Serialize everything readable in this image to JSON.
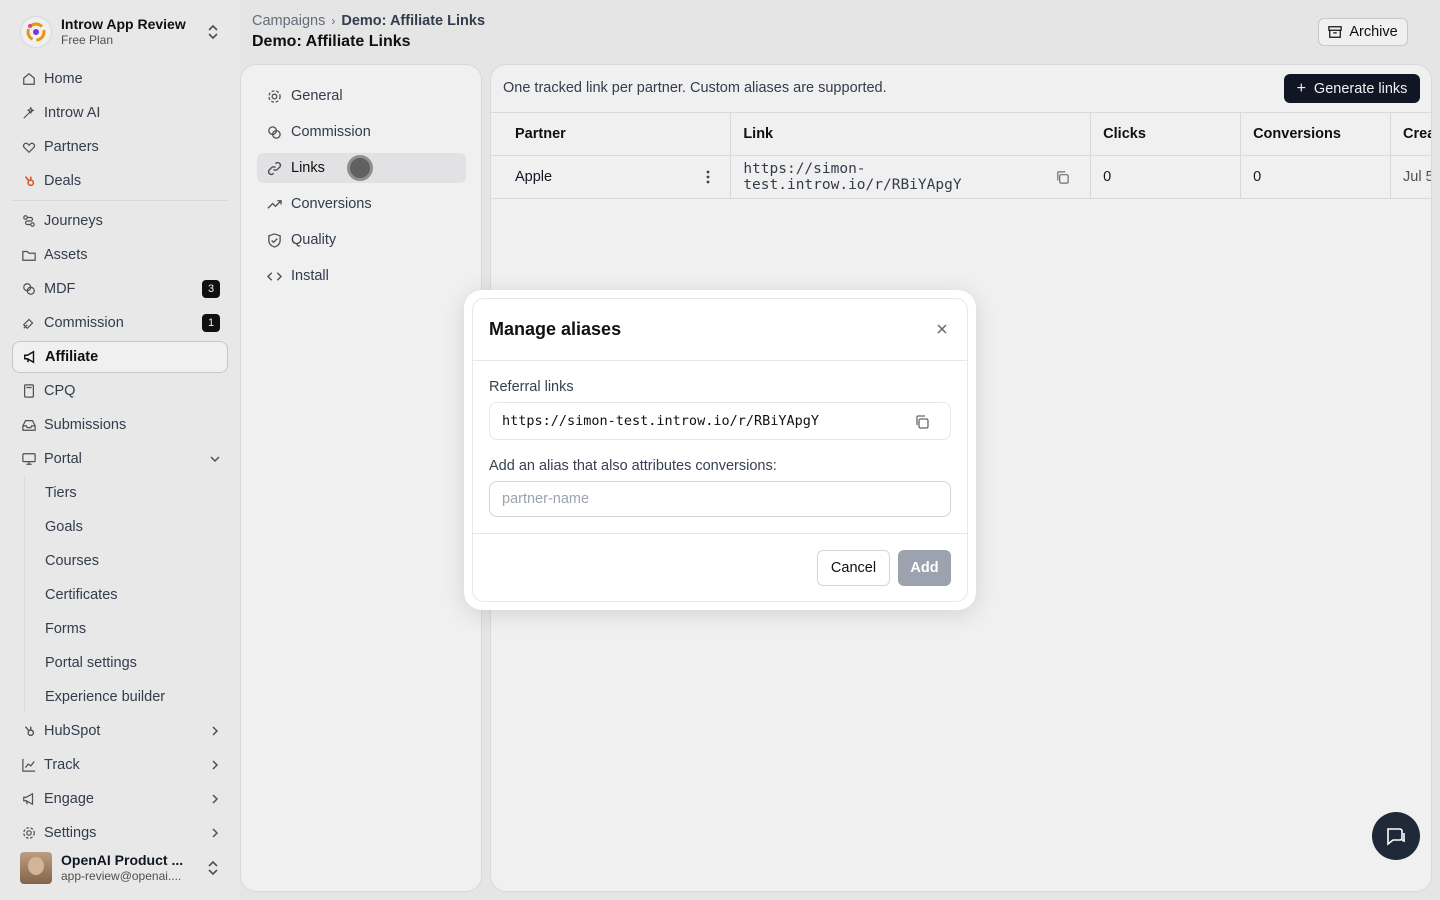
{
  "org": {
    "name": "Introw App Review",
    "plan": "Free Plan"
  },
  "nav": {
    "items": [
      {
        "label": "Home",
        "icon": "home-icon"
      },
      {
        "label": "Introw AI",
        "icon": "sparkle-icon"
      },
      {
        "label": "Partners",
        "icon": "handshake-icon"
      },
      {
        "label": "Deals",
        "icon": "hubspot-icon"
      }
    ],
    "items2": [
      {
        "label": "Journeys",
        "icon": "journey-icon"
      },
      {
        "label": "Assets",
        "icon": "folder-icon"
      },
      {
        "label": "MDF",
        "icon": "coins-icon",
        "badge": "3"
      },
      {
        "label": "Commission",
        "icon": "commission-icon",
        "badge": "1"
      },
      {
        "label": "Affiliate",
        "icon": "megaphone-icon"
      },
      {
        "label": "CPQ",
        "icon": "calculator-icon"
      },
      {
        "label": "Submissions",
        "icon": "inbox-icon"
      },
      {
        "label": "Portal",
        "icon": "monitor-icon"
      }
    ],
    "portal_sub": [
      "Tiers",
      "Goals",
      "Courses",
      "Certificates",
      "Forms",
      "Portal settings",
      "Experience builder"
    ],
    "items3": [
      {
        "label": "HubSpot",
        "icon": "hubspot-icon"
      },
      {
        "label": "Track",
        "icon": "chart-line-icon"
      },
      {
        "label": "Engage",
        "icon": "megaphone-icon"
      },
      {
        "label": "Settings",
        "icon": "gear-icon"
      }
    ]
  },
  "user": {
    "name": "OpenAI Product ...",
    "email": "app-review@openai...."
  },
  "header": {
    "crumb1": "Campaigns",
    "crumb_sep": "›",
    "crumb2": "Demo: Affiliate Links",
    "title": "Demo: Affiliate Links",
    "archive_label": "Archive"
  },
  "settings_menu": [
    "General",
    "Commission",
    "Links",
    "Conversions",
    "Quality",
    "Install"
  ],
  "links": {
    "description": "One tracked link per partner. Custom aliases are supported.",
    "generate_label": "Generate links",
    "columns": [
      "Partner",
      "Link",
      "Clicks",
      "Conversions",
      "Crea"
    ],
    "rows": [
      {
        "partner": "Apple",
        "link": "https://simon-test.introw.io/r/RBiYApgY",
        "clicks": "0",
        "conversions": "0",
        "created": "Jul 5"
      }
    ]
  },
  "modal": {
    "title": "Manage aliases",
    "referral_label": "Referral links",
    "referral_link": "https://simon-test.introw.io/r/RBiYApgY",
    "alias_label": "Add an alias that also attributes conversions:",
    "alias_placeholder": "partner-name",
    "alias_value": "",
    "cancel_label": "Cancel",
    "add_label": "Add"
  }
}
